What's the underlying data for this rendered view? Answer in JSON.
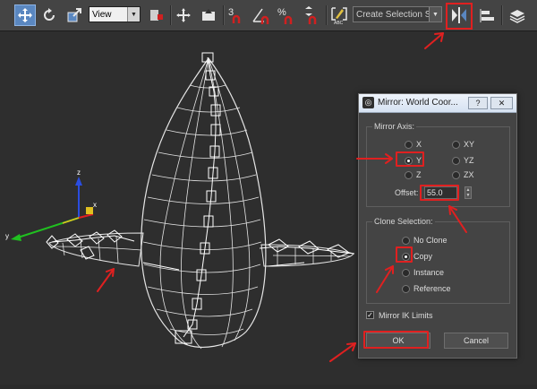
{
  "toolbar": {
    "view_dropdown": "View",
    "snap_3d": "3",
    "percent_snap": "%",
    "selection_set_placeholder": "Create Selection Se",
    "icons": [
      "select-move-icon",
      "rotate-icon",
      "scale-icon",
      "reference-coord-icon",
      "pivot-center-icon",
      "manipulate-icon",
      "keyboard-shortcut-icon",
      "snap-toggle-icon",
      "angle-snap-icon",
      "percent-snap-icon",
      "spinner-snap-icon",
      "edit-named-selection-icon",
      "mirror-icon",
      "align-icon",
      "layer-manager-icon"
    ]
  },
  "viewport": {
    "gizmo_axes": [
      "x",
      "y",
      "z"
    ]
  },
  "dialog": {
    "title": "Mirror: World Coor...",
    "help_label": "?",
    "close_label": "✕",
    "mirror_axis": {
      "label": "Mirror Axis:",
      "options": [
        "X",
        "Y",
        "Z",
        "XY",
        "YZ",
        "ZX"
      ],
      "selected": "Y"
    },
    "offset": {
      "label": "Offset:",
      "value": "55.0"
    },
    "clone_selection": {
      "label": "Clone Selection:",
      "options": [
        "No Clone",
        "Copy",
        "Instance",
        "Reference"
      ],
      "selected": "Copy"
    },
    "mirror_ik": {
      "label": "Mirror IK Limits",
      "checked": true
    },
    "ok_label": "OK",
    "cancel_label": "Cancel"
  },
  "colors": {
    "annotation": "#e02020",
    "active_tool": "#5a87c0",
    "wireframe": "#e6e6e6"
  }
}
